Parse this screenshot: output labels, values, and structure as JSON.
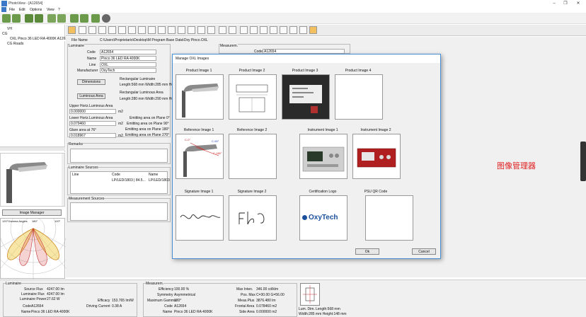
{
  "window": {
    "title": "PhotoView - [A12654]"
  },
  "menu": [
    "File",
    "Edit",
    "Options",
    "View",
    "?"
  ],
  "tree": {
    "items": [
      "VH",
      "CG",
      "OXL Pinco 36 LED RA 4000K A12654",
      "CG Roads"
    ]
  },
  "file": {
    "label": "File Name",
    "path": "C:\\Users\\Proprietario\\Desktop\\M Program Base Data\\Oxy Pinco.OXL"
  },
  "luminaire": {
    "group": "Luminaire",
    "code_label": "Code",
    "code": "A12654",
    "name_label": "Name",
    "name": "Pinco 36 LED RA 4000K",
    "line_label": "Line",
    "line": "OXL",
    "manufacturer_label": "Manufacturer",
    "manufacturer": "OxyTech",
    "dimensions_btn": "Dimensions",
    "luminous_area_btn": "Luminous Area",
    "rect_lum": "Rectangular Luminaire",
    "rect_lum_dims": "Length:568 mm  Width:285 mm  Heig",
    "rect_area": "Rectangular Luminous Area",
    "rect_area_dims": "Length:280 mm  Width:290 mm  Heig",
    "upper_area_label": "Upper Horiz.Luminous Area",
    "upper_area": "0.000000",
    "upper_unit": "m2",
    "lower_area_label": "Lower Horiz.Luminous Area",
    "lower_area": "0.079460",
    "lower_unit": "m2",
    "glare_label": "Glare area at 76°",
    "glare": "0.018967",
    "glare_unit": "m2",
    "emit0": "Emitting area on Plane 0°",
    "emit90": "Emitting area on Plane 90°",
    "emit180": "Emitting area on Plane 180°",
    "emit270": "Emitting area on Plane 270°"
  },
  "measurem_top": {
    "label": "Measurem.",
    "code_label": "Code",
    "code": "A12654"
  },
  "remarks": {
    "label": "Remarks"
  },
  "sources": {
    "label": "Luminaire Sources",
    "cols": [
      "Line",
      "Code",
      "Name"
    ],
    "row": [
      "",
      "LP/LED/1803 | 84.5...",
      "LP/LED/1803"
    ]
  },
  "meas_sources": {
    "label": "Measurement Sources"
  },
  "image_manager_btn": "Image Manager",
  "polar": {
    "label_left": "120°Gamma Angles",
    "label_top": "180°",
    "label_right": "120°"
  },
  "dialog": {
    "title": "Manage OXL Images",
    "captions": [
      "Product Image 1",
      "Product Image 2",
      "Product Image 3",
      "Product Image 4",
      "Reference Image 1",
      "Reference Image 2",
      "Instrument Image 1",
      "Instrument Image 2",
      "Signature Image 1",
      "Signature Image 2",
      "Certification Logo",
      "PSU QR Code"
    ],
    "logo": "OxyTech",
    "ok": "Ok",
    "cancel": "Cancel",
    "ref_labels": [
      "C-0°",
      "C-90°",
      "C-180°"
    ]
  },
  "annotation": "图像管理器",
  "bottom": {
    "lum_group": "Luminaire",
    "source_flux_l": "Source Flux",
    "source_flux": "4247.00 lm",
    "lum_flux_l": "Luminaire Flux",
    "lum_flux": "4247.00 lm",
    "lum_power_l": "Luminaire Power",
    "lum_power": "27.62 W",
    "code_l": "Code",
    "code": "A12654",
    "name_l": "Name",
    "name": "Pinco 36 LED RA 4000K",
    "efficacy_l": "Efficacy",
    "efficacy": "153.765 lm/W",
    "driving_l": "Driving Current",
    "driving": "0.38 A",
    "meas_group": "Measurem.",
    "efficiency_l": "Efficiency",
    "efficiency": "100.00 %",
    "symmetry_l": "Symmetry",
    "symmetry": "Asymmetrical",
    "maxgamma_l": "Maximum Gamma",
    "maxgamma": "180°",
    "mcode_l": "Code",
    "mcode": "A12654",
    "mname_l": "Name",
    "mname": "Pinco 36 LED RA 4000K",
    "maxint_l": "Max Inten.",
    "maxint": "346.00 cd/klm",
    "pos_l": "Pos. Max",
    "pos": "C=30.00 G=56.00",
    "meaplus_l": "Meas.Plus",
    "meaplus": "3876.480 lm",
    "frontal_l": "Frontal Area",
    "frontal": "0.078460 m2",
    "side_l": "Side Area",
    "side": "0.000000 m2",
    "dims_l": "Lum. Dim.",
    "dims1": "Length:568 mm",
    "dims2": "Width:285 mm  Height:148 mm"
  },
  "colors": {
    "dialog_border": "#4a8cd0",
    "annotation": "#e02020",
    "logo": "#1a4f9c"
  }
}
